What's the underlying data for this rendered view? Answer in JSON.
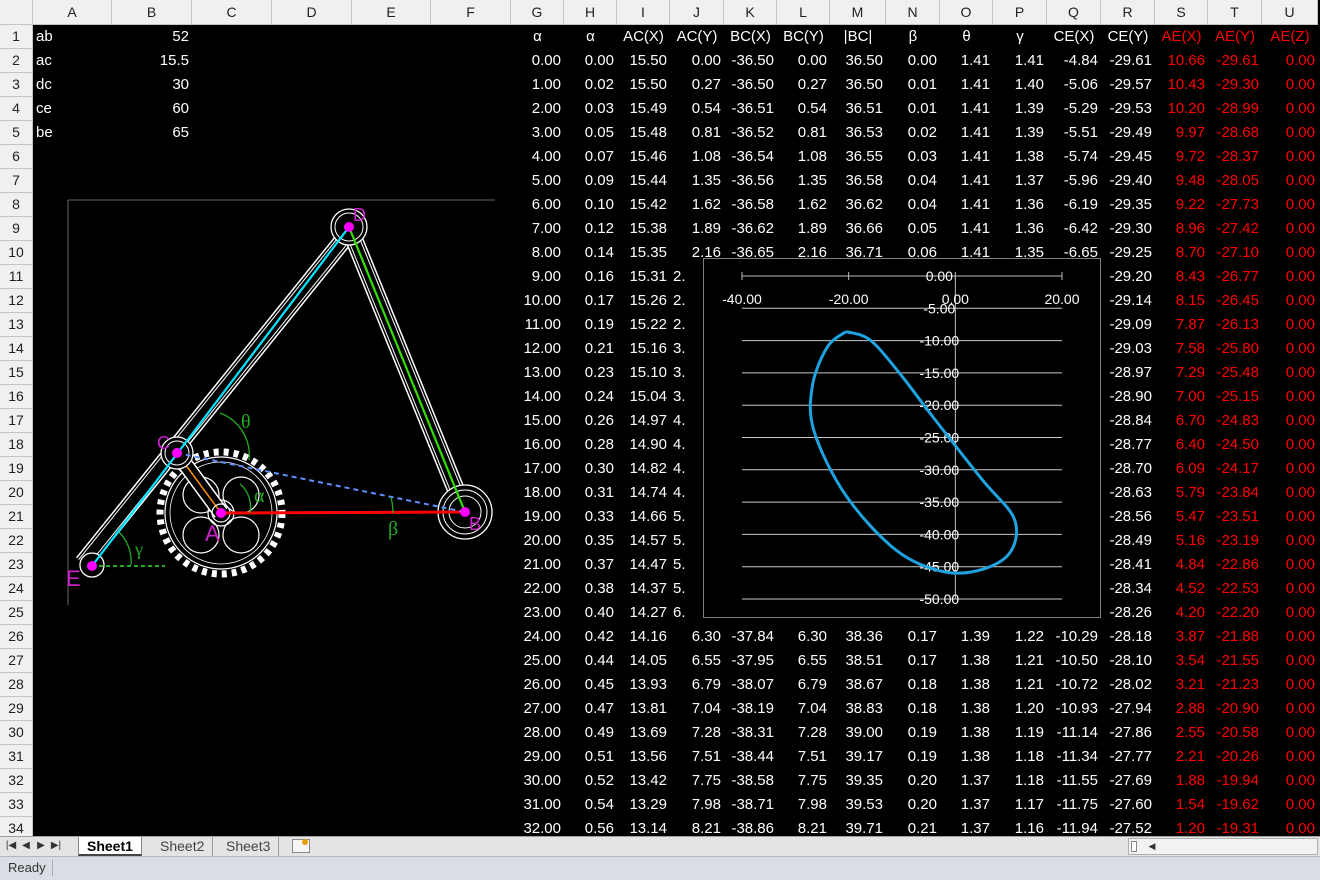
{
  "columns": [
    "A",
    "B",
    "C",
    "D",
    "E",
    "F",
    "G",
    "H",
    "I",
    "J",
    "K",
    "L",
    "M",
    "N",
    "O",
    "P",
    "Q",
    "R",
    "S",
    "T",
    "U"
  ],
  "params": [
    {
      "name": "ab",
      "value": "52"
    },
    {
      "name": "ac",
      "value": "15.5"
    },
    {
      "name": "dc",
      "value": "30"
    },
    {
      "name": "ce",
      "value": "60"
    },
    {
      "name": "be",
      "value": "65"
    }
  ],
  "table_headers": [
    "α",
    "α",
    "AC(X)",
    "AC(Y)",
    "BC(X)",
    "BC(Y)",
    "|BC|",
    "β",
    "θ",
    "γ",
    "CE(X)",
    "CE(Y)",
    "AE(X)",
    "AE(Y)",
    "AE(Z)"
  ],
  "table_rows": [
    [
      "0.00",
      "0.00",
      "15.50",
      "0.00",
      "-36.50",
      "0.00",
      "36.50",
      "0.00",
      "1.41",
      "1.41",
      "-4.84",
      "-29.61",
      "10.66",
      "-29.61",
      "0.00"
    ],
    [
      "1.00",
      "0.02",
      "15.50",
      "0.27",
      "-36.50",
      "0.27",
      "36.50",
      "0.01",
      "1.41",
      "1.40",
      "-5.06",
      "-29.57",
      "10.43",
      "-29.30",
      "0.00"
    ],
    [
      "2.00",
      "0.03",
      "15.49",
      "0.54",
      "-36.51",
      "0.54",
      "36.51",
      "0.01",
      "1.41",
      "1.39",
      "-5.29",
      "-29.53",
      "10.20",
      "-28.99",
      "0.00"
    ],
    [
      "3.00",
      "0.05",
      "15.48",
      "0.81",
      "-36.52",
      "0.81",
      "36.53",
      "0.02",
      "1.41",
      "1.39",
      "-5.51",
      "-29.49",
      "9.97",
      "-28.68",
      "0.00"
    ],
    [
      "4.00",
      "0.07",
      "15.46",
      "1.08",
      "-36.54",
      "1.08",
      "36.55",
      "0.03",
      "1.41",
      "1.38",
      "-5.74",
      "-29.45",
      "9.72",
      "-28.37",
      "0.00"
    ],
    [
      "5.00",
      "0.09",
      "15.44",
      "1.35",
      "-36.56",
      "1.35",
      "36.58",
      "0.04",
      "1.41",
      "1.37",
      "-5.96",
      "-29.40",
      "9.48",
      "-28.05",
      "0.00"
    ],
    [
      "6.00",
      "0.10",
      "15.42",
      "1.62",
      "-36.58",
      "1.62",
      "36.62",
      "0.04",
      "1.41",
      "1.36",
      "-6.19",
      "-29.35",
      "9.22",
      "-27.73",
      "0.00"
    ],
    [
      "7.00",
      "0.12",
      "15.38",
      "1.89",
      "-36.62",
      "1.89",
      "36.66",
      "0.05",
      "1.41",
      "1.36",
      "-6.42",
      "-29.30",
      "8.96",
      "-27.42",
      "0.00"
    ],
    [
      "8.00",
      "0.14",
      "15.35",
      "2.16",
      "-36.65",
      "2.16",
      "36.71",
      "0.06",
      "1.41",
      "1.35",
      "-6.65",
      "-29.25",
      "8.70",
      "-27.10",
      "0.00"
    ],
    [
      "9.00",
      "0.16",
      "15.31",
      "2.",
      "",
      "",
      "",
      "",
      "",
      "",
      "",
      "-29.20",
      "8.43",
      "-26.77",
      "0.00"
    ],
    [
      "10.00",
      "0.17",
      "15.26",
      "2.",
      "",
      "",
      "",
      "",
      "",
      "",
      "",
      "-29.14",
      "8.15",
      "-26.45",
      "0.00"
    ],
    [
      "11.00",
      "0.19",
      "15.22",
      "2.",
      "",
      "",
      "",
      "",
      "",
      "",
      "",
      "-29.09",
      "7.87",
      "-26.13",
      "0.00"
    ],
    [
      "12.00",
      "0.21",
      "15.16",
      "3.",
      "",
      "",
      "",
      "",
      "",
      "",
      "",
      "-29.03",
      "7.58",
      "-25.80",
      "0.00"
    ],
    [
      "13.00",
      "0.23",
      "15.10",
      "3.",
      "",
      "",
      "",
      "",
      "",
      "",
      "",
      "-28.97",
      "7.29",
      "-25.48",
      "0.00"
    ],
    [
      "14.00",
      "0.24",
      "15.04",
      "3.",
      "",
      "",
      "",
      "",
      "",
      "",
      "",
      "-28.90",
      "7.00",
      "-25.15",
      "0.00"
    ],
    [
      "15.00",
      "0.26",
      "14.97",
      "4.",
      "",
      "",
      "",
      "",
      "",
      "",
      "",
      "-28.84",
      "6.70",
      "-24.83",
      "0.00"
    ],
    [
      "16.00",
      "0.28",
      "14.90",
      "4.",
      "",
      "",
      "",
      "",
      "",
      "",
      "",
      "-28.77",
      "6.40",
      "-24.50",
      "0.00"
    ],
    [
      "17.00",
      "0.30",
      "14.82",
      "4.",
      "",
      "",
      "",
      "",
      "",
      "",
      "",
      "-28.70",
      "6.09",
      "-24.17",
      "0.00"
    ],
    [
      "18.00",
      "0.31",
      "14.74",
      "4.",
      "",
      "",
      "",
      "",
      "",
      "",
      "",
      "-28.63",
      "5.79",
      "-23.84",
      "0.00"
    ],
    [
      "19.00",
      "0.33",
      "14.66",
      "5.",
      "",
      "",
      "",
      "",
      "",
      "",
      "",
      "-28.56",
      "5.47",
      "-23.51",
      "0.00"
    ],
    [
      "20.00",
      "0.35",
      "14.57",
      "5.",
      "",
      "",
      "",
      "",
      "",
      "",
      "",
      "-28.49",
      "5.16",
      "-23.19",
      "0.00"
    ],
    [
      "21.00",
      "0.37",
      "14.47",
      "5.",
      "",
      "",
      "",
      "",
      "",
      "",
      "",
      "-28.41",
      "4.84",
      "-22.86",
      "0.00"
    ],
    [
      "22.00",
      "0.38",
      "14.37",
      "5.",
      "",
      "",
      "",
      "",
      "",
      "",
      "",
      "-28.34",
      "4.52",
      "-22.53",
      "0.00"
    ],
    [
      "23.00",
      "0.40",
      "14.27",
      "6.",
      "",
      "",
      "",
      "",
      "",
      "",
      "",
      "-28.26",
      "4.20",
      "-22.20",
      "0.00"
    ],
    [
      "24.00",
      "0.42",
      "14.16",
      "6.30",
      "-37.84",
      "6.30",
      "38.36",
      "0.17",
      "1.39",
      "1.22",
      "-10.29",
      "-28.18",
      "3.87",
      "-21.88",
      "0.00"
    ],
    [
      "25.00",
      "0.44",
      "14.05",
      "6.55",
      "-37.95",
      "6.55",
      "38.51",
      "0.17",
      "1.38",
      "1.21",
      "-10.50",
      "-28.10",
      "3.54",
      "-21.55",
      "0.00"
    ],
    [
      "26.00",
      "0.45",
      "13.93",
      "6.79",
      "-38.07",
      "6.79",
      "38.67",
      "0.18",
      "1.38",
      "1.21",
      "-10.72",
      "-28.02",
      "3.21",
      "-21.23",
      "0.00"
    ],
    [
      "27.00",
      "0.47",
      "13.81",
      "7.04",
      "-38.19",
      "7.04",
      "38.83",
      "0.18",
      "1.38",
      "1.20",
      "-10.93",
      "-27.94",
      "2.88",
      "-20.90",
      "0.00"
    ],
    [
      "28.00",
      "0.49",
      "13.69",
      "7.28",
      "-38.31",
      "7.28",
      "39.00",
      "0.19",
      "1.38",
      "1.19",
      "-11.14",
      "-27.86",
      "2.55",
      "-20.58",
      "0.00"
    ],
    [
      "29.00",
      "0.51",
      "13.56",
      "7.51",
      "-38.44",
      "7.51",
      "39.17",
      "0.19",
      "1.38",
      "1.18",
      "-11.34",
      "-27.77",
      "2.21",
      "-20.26",
      "0.00"
    ],
    [
      "30.00",
      "0.52",
      "13.42",
      "7.75",
      "-38.58",
      "7.75",
      "39.35",
      "0.20",
      "1.37",
      "1.18",
      "-11.55",
      "-27.69",
      "1.88",
      "-19.94",
      "0.00"
    ],
    [
      "31.00",
      "0.54",
      "13.29",
      "7.98",
      "-38.71",
      "7.98",
      "39.53",
      "0.20",
      "1.37",
      "1.17",
      "-11.75",
      "-27.60",
      "1.54",
      "-19.62",
      "0.00"
    ],
    [
      "32.00",
      "0.56",
      "13.14",
      "8.21",
      "-38.86",
      "8.21",
      "39.71",
      "0.21",
      "1.37",
      "1.16",
      "-11.94",
      "-27.52",
      "1.20",
      "-19.31",
      "0.00"
    ]
  ],
  "drawing_labels": {
    "D": "D",
    "C": "C",
    "A": "A",
    "B": "B",
    "E": "E",
    "theta": "θ",
    "alpha": "α",
    "beta": "β",
    "gamma": "γ"
  },
  "chart_data": {
    "type": "scatter",
    "title": "",
    "xlabel": "",
    "ylabel": "",
    "xlim": [
      -40,
      20
    ],
    "ylim": [
      -50,
      0
    ],
    "x_ticks": [
      "-40.00",
      "-20.00",
      "0.00",
      "20.00"
    ],
    "y_ticks": [
      "0.00",
      "-5.00",
      "-10.00",
      "-15.00",
      "-20.00",
      "-25.00",
      "-30.00",
      "-35.00",
      "-40.00",
      "-45.00",
      "-50.00"
    ],
    "grid": "horizontal",
    "line_color": "#1fa2e0",
    "series": [
      {
        "points": [
          [
            -20.5,
            -8.6
          ],
          [
            -16,
            -9.9
          ],
          [
            -10.5,
            -15
          ],
          [
            -4.5,
            -21.5
          ],
          [
            5,
            -31.5
          ],
          [
            11,
            -37.5
          ],
          [
            10.5,
            -42.5
          ],
          [
            5.5,
            -45.3
          ],
          [
            -2,
            -45.8
          ],
          [
            -11,
            -42.5
          ],
          [
            -20.5,
            -34
          ],
          [
            -26.5,
            -24
          ],
          [
            -26.8,
            -17
          ],
          [
            -24,
            -11
          ],
          [
            -20.5,
            -8.6
          ]
        ]
      }
    ]
  },
  "sheet_tabs": [
    {
      "label": "Sheet1",
      "active": true
    },
    {
      "label": "Sheet2",
      "active": false
    },
    {
      "label": "Sheet3",
      "active": false
    }
  ],
  "nav_buttons": [
    "|◀",
    "◀",
    "▶",
    "▶|"
  ],
  "status": {
    "ready": "Ready"
  }
}
